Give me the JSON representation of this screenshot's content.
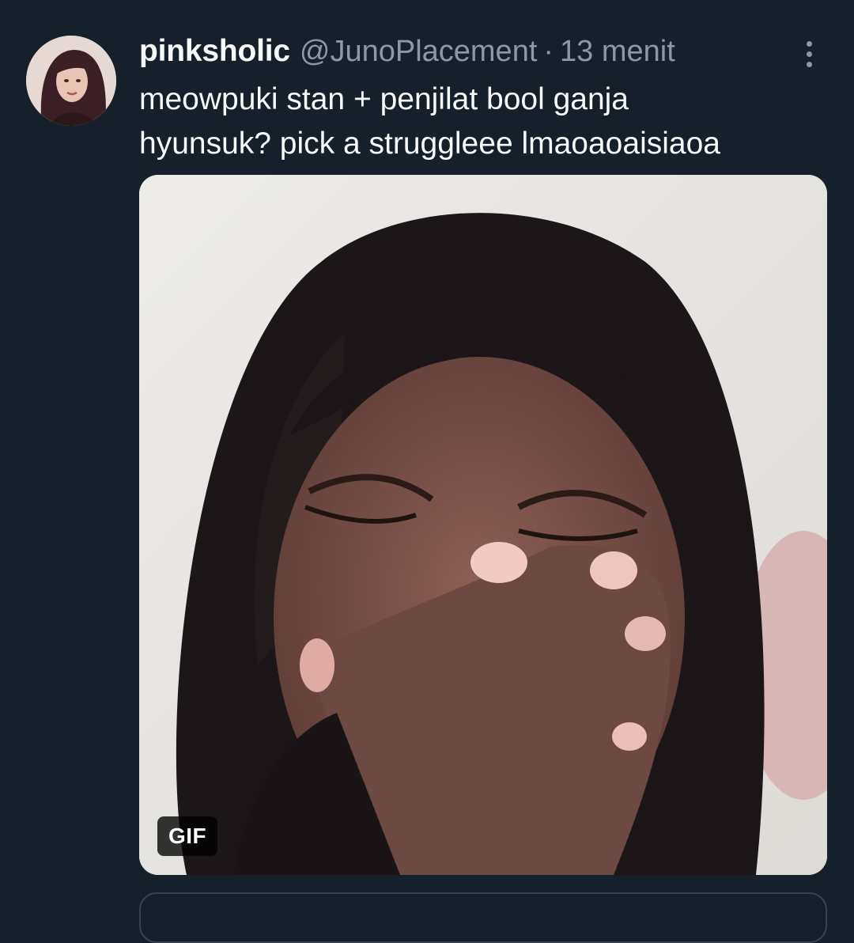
{
  "tweet": {
    "display_name": "pinksholic",
    "handle": "@JunoPlacement",
    "separator": "·",
    "timestamp": "13 menit",
    "text_lines": [
      "meowpuki stan + penjilat bool ganja",
      "hyunsuk? pick a struggleee lmaoaoaisiaoa"
    ],
    "media": {
      "type": "gif",
      "badge": "GIF"
    },
    "more_icon": "more-vertical-icon"
  },
  "colors": {
    "background": "#15202b",
    "primary_text": "#f7f9f9",
    "secondary_text": "#8b98a5",
    "border": "#38444d"
  }
}
